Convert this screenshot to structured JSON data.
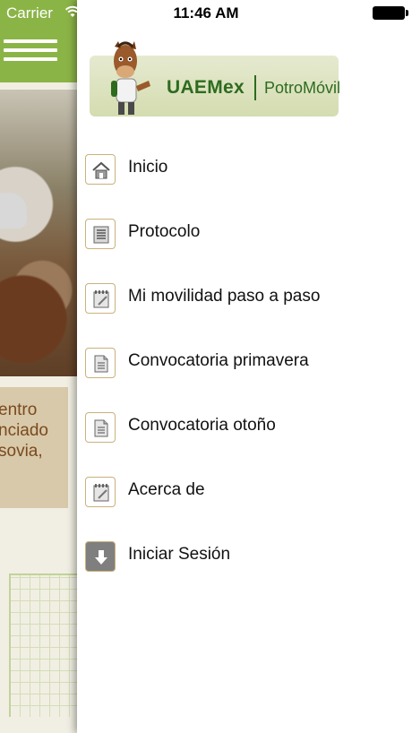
{
  "status_bar": {
    "carrier": "Carrier",
    "time": "11:46 AM"
  },
  "background_page": {
    "text_lines": [
      "entro",
      "nciado",
      "sovia,"
    ]
  },
  "logo": {
    "brand": "UAEMex",
    "app_name": "PotroMóvil"
  },
  "menu": {
    "items": [
      {
        "label": "Inicio",
        "icon": "home-icon"
      },
      {
        "label": "Protocolo",
        "icon": "document-list-icon"
      },
      {
        "label": "Mi movilidad paso a paso",
        "icon": "notepad-icon"
      },
      {
        "label": "Convocatoria primavera",
        "icon": "document-icon"
      },
      {
        "label": "Convocatoria otoño",
        "icon": "document-icon"
      },
      {
        "label": "Acerca de",
        "icon": "notepad-icon"
      },
      {
        "label": "Iniciar Sesión",
        "icon": "download-icon"
      }
    ]
  },
  "colors": {
    "header_green": "#8bb447",
    "icon_border": "#c9b27a",
    "logo_text": "#2e6b1f"
  }
}
